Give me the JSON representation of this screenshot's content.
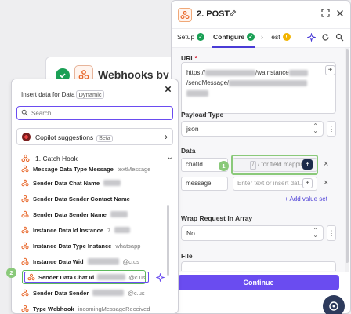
{
  "background_card": {
    "title": "Webhooks by Zap"
  },
  "right_panel": {
    "step_title": "2. POST",
    "tabs": [
      {
        "label": "Setup",
        "status": "ok"
      },
      {
        "label": "Configure",
        "status": "ok"
      },
      {
        "label": "Test",
        "status": "warning",
        "badge": "!"
      }
    ],
    "url": {
      "label": "URL",
      "required_mark": "*",
      "line1_prefix": "https://",
      "line1_suffix": "/waInstance",
      "line2_prefix": "/sendMessage/"
    },
    "payload_type": {
      "label": "Payload Type",
      "value": "json"
    },
    "data": {
      "label": "Data",
      "rows": [
        {
          "key": "chatId",
          "value_placeholder": "/ for field mapping"
        },
        {
          "key": "message",
          "value_placeholder": "Enter text or insert dat..."
        }
      ],
      "add_label": "Add value set"
    },
    "wrap_request": {
      "label": "Wrap Request In Array",
      "value": "No"
    },
    "file": {
      "label": "File"
    },
    "continue_label": "Continue"
  },
  "left_panel": {
    "title": "Insert data for Data",
    "mode_badge": "Dynamic",
    "search": {
      "placeholder": "Search",
      "value": ""
    },
    "copilot": {
      "label": "Copilot suggestions",
      "badge": "Beta"
    },
    "section": {
      "number": "1.",
      "label": "Catch Hook"
    },
    "items": [
      {
        "key": "Message Data Type Message",
        "value": "textMessage"
      },
      {
        "key": "Sender Data Chat Name",
        "value": ""
      },
      {
        "key": "Sender Data Sender Contact Name",
        "value": ""
      },
      {
        "key": "Sender Data Sender Name",
        "value": ""
      },
      {
        "key": "Instance Data Id Instance",
        "value": "7"
      },
      {
        "key": "Instance Data Type Instance",
        "value": "whatsapp"
      },
      {
        "key": "Instance Data Wid",
        "value": "@c.us"
      },
      {
        "key": "Sender Data Chat Id",
        "value": "@c.us"
      },
      {
        "key": "Sender Data Sender",
        "value": "@c.us"
      },
      {
        "key": "Type Webhook",
        "value": "incomingMessageReceived"
      }
    ]
  },
  "annotations": {
    "step1": "1",
    "step2": "2"
  },
  "colors": {
    "accent": "#6a4cf0",
    "success": "#1aa055",
    "highlight": "#8ac97a",
    "warning": "#f2b400",
    "brand_orange": "#e8672a"
  }
}
